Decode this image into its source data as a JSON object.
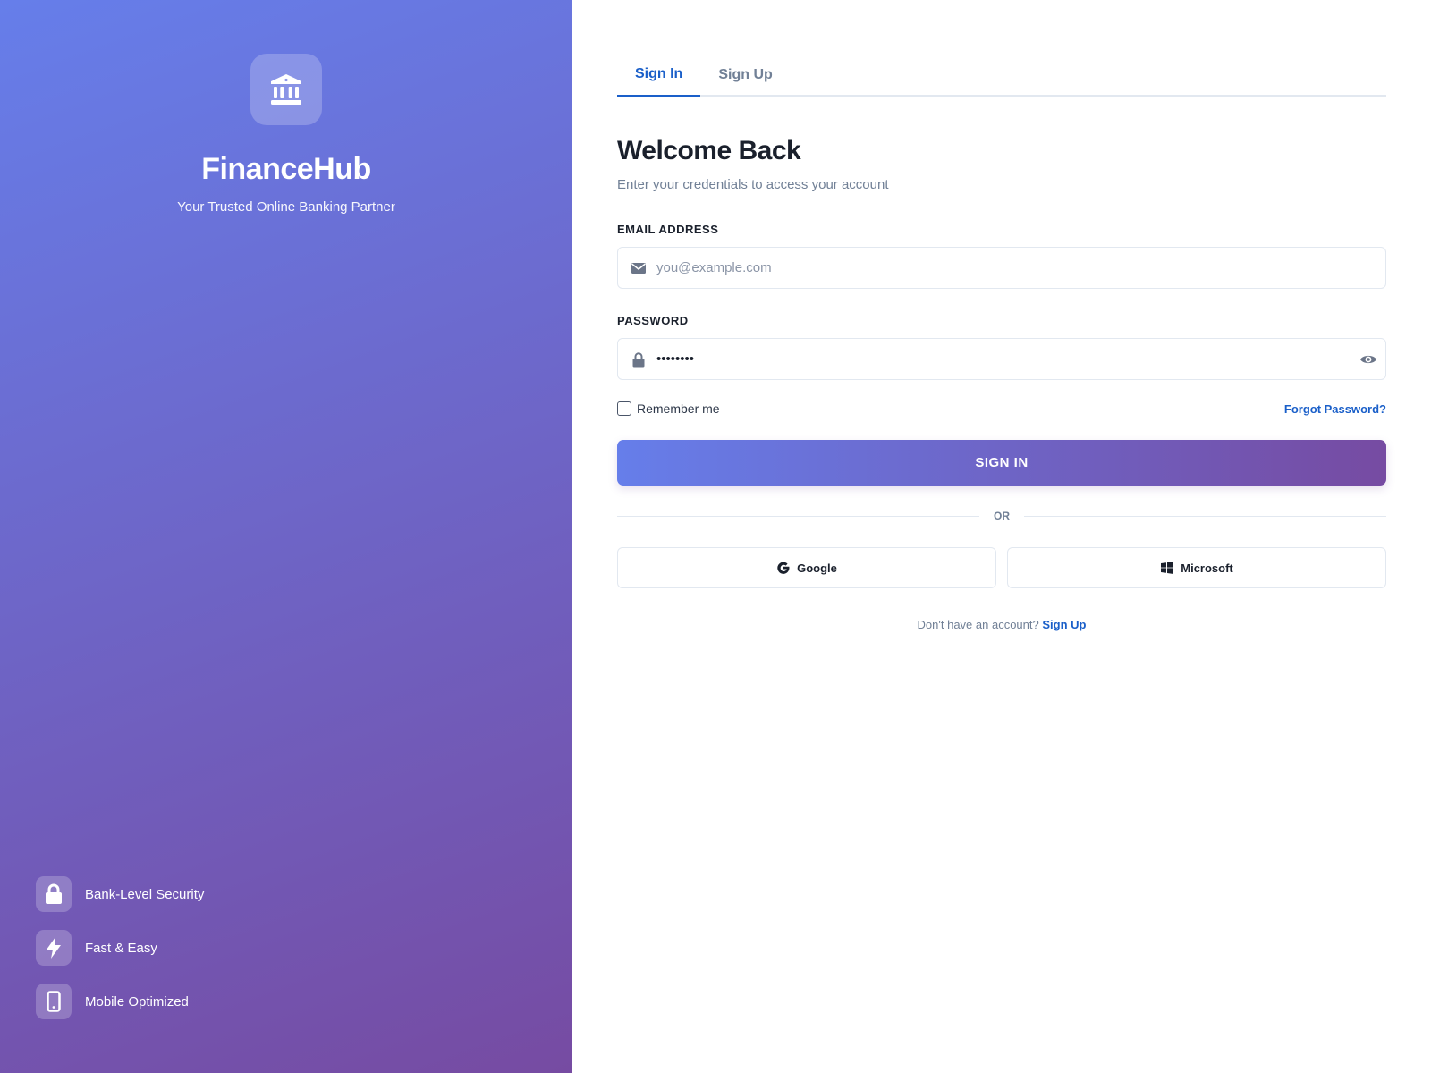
{
  "brand": {
    "name": "FinanceHub",
    "tagline": "Your Trusted Online Banking Partner",
    "logo_icon": "bank-icon"
  },
  "features": [
    {
      "label": "Bank-Level Security",
      "icon": "lock-icon"
    },
    {
      "label": "Fast & Easy",
      "icon": "lightning-icon"
    },
    {
      "label": "Mobile Optimized",
      "icon": "mobile-icon"
    }
  ],
  "tabs": [
    {
      "label": "Sign In",
      "active": true
    },
    {
      "label": "Sign Up",
      "active": false
    }
  ],
  "form": {
    "title": "Welcome Back",
    "subtitle": "Enter your credentials to access your account",
    "email_label": "EMAIL ADDRESS",
    "email_placeholder": "you@example.com",
    "email_value": "",
    "password_label": "PASSWORD",
    "password_value": "••••••••",
    "remember_label": "Remember me",
    "remember_checked": false,
    "forgot_label": "Forgot Password?",
    "submit_label": "SIGN IN",
    "divider_label": "OR",
    "google_label": "Google",
    "microsoft_label": "Microsoft",
    "no_account_text": "Don't have an account?",
    "signup_link": "Sign Up"
  },
  "colors": {
    "gradient_start": "#667eea",
    "gradient_end": "#764ba2",
    "accent": "#1a5fc9",
    "text_dark": "#1a202c",
    "text_muted": "#718096"
  }
}
